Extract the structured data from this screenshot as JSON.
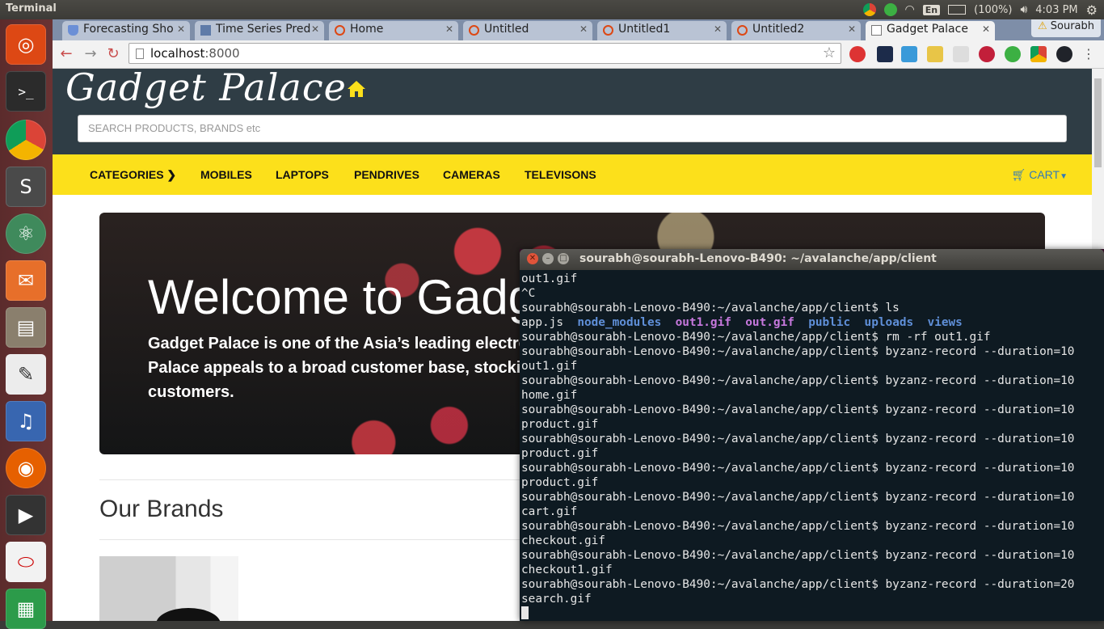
{
  "top_panel": {
    "app_title": "Terminal",
    "keyboard": "En",
    "battery": "(100%)",
    "time": "4:03 PM"
  },
  "tabs": [
    {
      "label": "Forecasting Sho"
    },
    {
      "label": "Time Series Pred"
    },
    {
      "label": "Home"
    },
    {
      "label": "Untitled"
    },
    {
      "label": "Untitled1"
    },
    {
      "label": "Untitled2"
    },
    {
      "label": "Gadget Palace"
    }
  ],
  "profile": {
    "name": "Sourabh"
  },
  "address": {
    "host": "localhost",
    "port": ":8000"
  },
  "site": {
    "brand": "Gadget Palace",
    "search_placeholder": "SEARCH PRODUCTS, BRANDS etc",
    "nav": [
      {
        "label": "CATEGORIES"
      },
      {
        "label": "MOBILES"
      },
      {
        "label": "LAPTOPS"
      },
      {
        "label": "PENDRIVES"
      },
      {
        "label": "CAMERAS"
      },
      {
        "label": "TELEVISONS"
      }
    ],
    "cart_label": "CART",
    "hero_title": "Welcome to Gadget Palace",
    "hero_text": "Gadget Palace is one of the Asia’s leading electronics retailers. Gadget Palace appeals to a broad customer base, stocking products for all customers.",
    "brands_title": "Our Brands"
  },
  "terminal": {
    "title": "sourabh@sourabh-Lenovo-B490: ~/avalanche/app/client",
    "prompt": "sourabh@sourabh-Lenovo-B490:~/avalanche/app/client$ ",
    "lines": [
      "out1.gif",
      "^C",
      "sourabh@sourabh-Lenovo-B490:~/avalanche/app/client$ ls",
      "LS_OUTPUT",
      "sourabh@sourabh-Lenovo-B490:~/avalanche/app/client$ rm -rf out1.gif",
      "sourabh@sourabh-Lenovo-B490:~/avalanche/app/client$ byzanz-record --duration=10",
      "out1.gif",
      "sourabh@sourabh-Lenovo-B490:~/avalanche/app/client$ byzanz-record --duration=10",
      "home.gif",
      "sourabh@sourabh-Lenovo-B490:~/avalanche/app/client$ byzanz-record --duration=10",
      "product.gif",
      "sourabh@sourabh-Lenovo-B490:~/avalanche/app/client$ byzanz-record --duration=10",
      "product.gif",
      "sourabh@sourabh-Lenovo-B490:~/avalanche/app/client$ byzanz-record --duration=10",
      "product.gif",
      "sourabh@sourabh-Lenovo-B490:~/avalanche/app/client$ byzanz-record --duration=10",
      "cart.gif",
      "sourabh@sourabh-Lenovo-B490:~/avalanche/app/client$ byzanz-record --duration=10",
      "checkout.gif",
      "sourabh@sourabh-Lenovo-B490:~/avalanche/app/client$ byzanz-record --duration=10",
      "checkout1.gif",
      "sourabh@sourabh-Lenovo-B490:~/avalanche/app/client$ byzanz-record --duration=20",
      "search.gif"
    ],
    "ls_output": [
      {
        "name": "app.js",
        "kind": "file"
      },
      {
        "name": "node_modules",
        "kind": "dir"
      },
      {
        "name": "out1.gif",
        "kind": "gif"
      },
      {
        "name": "out.gif",
        "kind": "gif"
      },
      {
        "name": "public",
        "kind": "dir"
      },
      {
        "name": "uploads",
        "kind": "dir"
      },
      {
        "name": "views",
        "kind": "dir"
      }
    ]
  },
  "colors": {
    "site_header": "#2f3d45",
    "navbar": "#fce01b",
    "home_icon": "#fce01b",
    "cart": "#337ab7",
    "launcher": "#5b2b2c",
    "terminal_bg": "#0e1a22"
  }
}
